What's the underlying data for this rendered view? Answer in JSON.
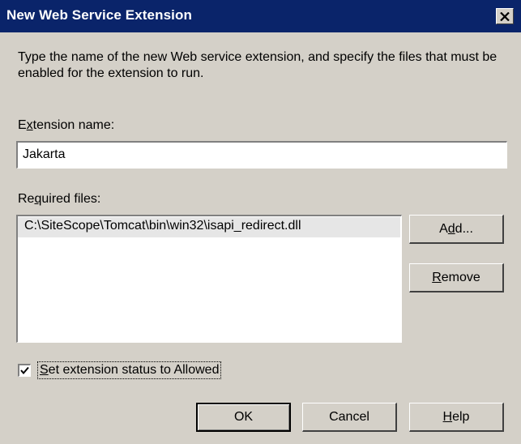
{
  "window": {
    "title": "New Web Service Extension",
    "close_icon": "close-icon"
  },
  "intro_text": "Type the name of the new Web service extension, and specify the files that must be enabled for the extension to run.",
  "extension_name": {
    "label_pre": "E",
    "label_accel": "x",
    "label_post": "tension name:",
    "value": "Jakarta"
  },
  "required_files": {
    "label_pre": "Re",
    "label_accel": "q",
    "label_post": "uired files:",
    "items": [
      "C:\\SiteScope\\Tomcat\\bin\\win32\\isapi_redirect.dll"
    ]
  },
  "buttons": {
    "add_pre": "A",
    "add_accel": "d",
    "add_post": "d...",
    "remove_accel": "R",
    "remove_post": "emove",
    "ok": "OK",
    "cancel": "Cancel",
    "help_accel": "H",
    "help_post": "elp"
  },
  "status_checkbox": {
    "checked": true,
    "label_accel": "S",
    "label_post": "et extension status to Allowed"
  },
  "colors": {
    "titlebar": "#0a246a",
    "dialog_bg": "#d4d0c8",
    "selected_item": "#e6e6e6"
  }
}
